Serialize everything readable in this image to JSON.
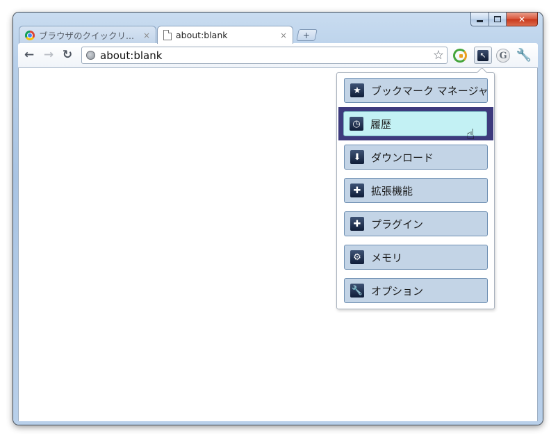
{
  "window": {
    "minimize_glyph": "",
    "maximize_glyph": "",
    "close_glyph": "✕"
  },
  "tabs": [
    {
      "title": "ブラウザのクイックリ...",
      "close": "×",
      "icon": "chrome-icon",
      "active": false
    },
    {
      "title": "about:blank",
      "close": "×",
      "icon": "page-icon",
      "active": true
    }
  ],
  "new_tab": {
    "glyph": "+"
  },
  "toolbar": {
    "back": "←",
    "forward": "→",
    "reload": "↻",
    "omnibox_value": "about:blank",
    "star": "☆",
    "wrench": "🔧",
    "google": "G"
  },
  "menu": {
    "items": [
      {
        "label": "ブックマーク マネージャ",
        "icon": "star-icon",
        "glyph": "★"
      },
      {
        "label": "履歴",
        "icon": "clock-icon",
        "glyph": "◷"
      },
      {
        "label": "ダウンロード",
        "icon": "download-icon",
        "glyph": "⬇"
      },
      {
        "label": "拡張機能",
        "icon": "puzzle-icon",
        "glyph": "✚"
      },
      {
        "label": "プラグイン",
        "icon": "plugin-icon",
        "glyph": "✚"
      },
      {
        "label": "メモリ",
        "icon": "gear-icon",
        "glyph": "⚙"
      },
      {
        "label": "オプション",
        "icon": "wrench-icon",
        "glyph": "🔧"
      }
    ],
    "hovered_index": 1
  },
  "colors": {
    "menu_item_bg": "#c3d4e6",
    "hover_frame": "#3d3a7d",
    "hover_bg": "#c3f1f4"
  }
}
